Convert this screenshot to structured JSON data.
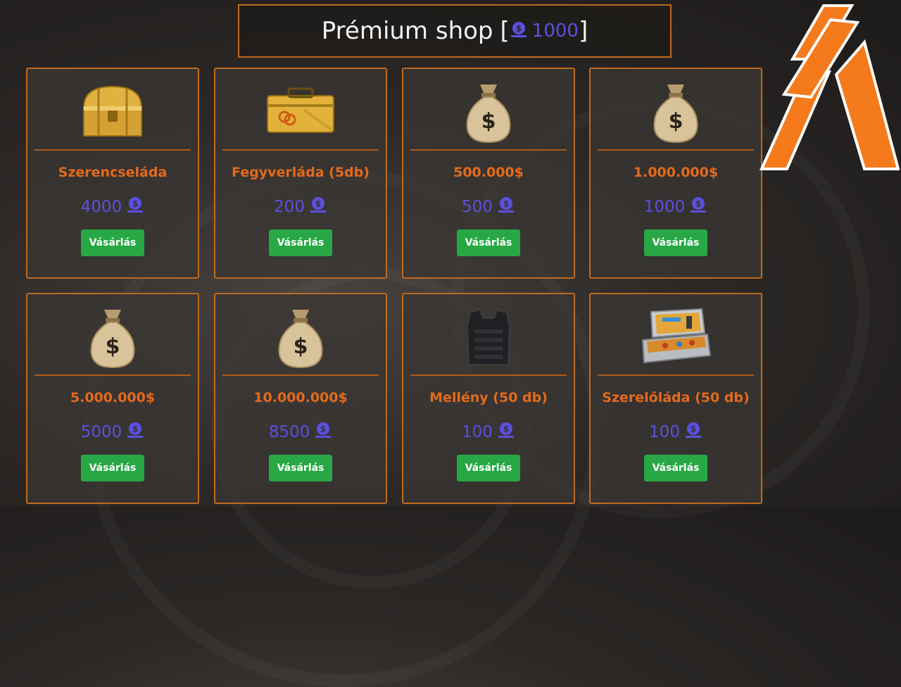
{
  "header": {
    "title": "Prémium shop",
    "bracket_open": "[",
    "bracket_close": "]",
    "balance": "1000"
  },
  "icons": {
    "currency": "premium-coin-icon",
    "logo": "fivem-logo"
  },
  "colors": {
    "accent_orange": "#e46a1c",
    "border_orange": "#c06a1c",
    "price_purple": "#5b50e0",
    "buy_green": "#27a844"
  },
  "items": [
    {
      "name": "Szerencseláda",
      "price": "4000",
      "button": "Vásárlás",
      "image": "golden-chest"
    },
    {
      "name": "Fegyverláda (5db)",
      "price": "200",
      "button": "Vásárlás",
      "image": "weapon-case"
    },
    {
      "name": "500.000$",
      "price": "500",
      "button": "Vásárlás",
      "image": "money-bag"
    },
    {
      "name": "1.000.000$",
      "price": "1000",
      "button": "Vásárlás",
      "image": "money-bag"
    },
    {
      "name": "5.000.000$",
      "price": "5000",
      "button": "Vásárlás",
      "image": "money-bag"
    },
    {
      "name": "10.000.000$",
      "price": "8500",
      "button": "Vásárlás",
      "image": "money-bag"
    },
    {
      "name": "Mellény (50 db)",
      "price": "100",
      "button": "Vásárlás",
      "image": "body-armor-vest"
    },
    {
      "name": "Szerelőláda (50 db)",
      "price": "100",
      "button": "Vásárlás",
      "image": "toolbox"
    }
  ]
}
